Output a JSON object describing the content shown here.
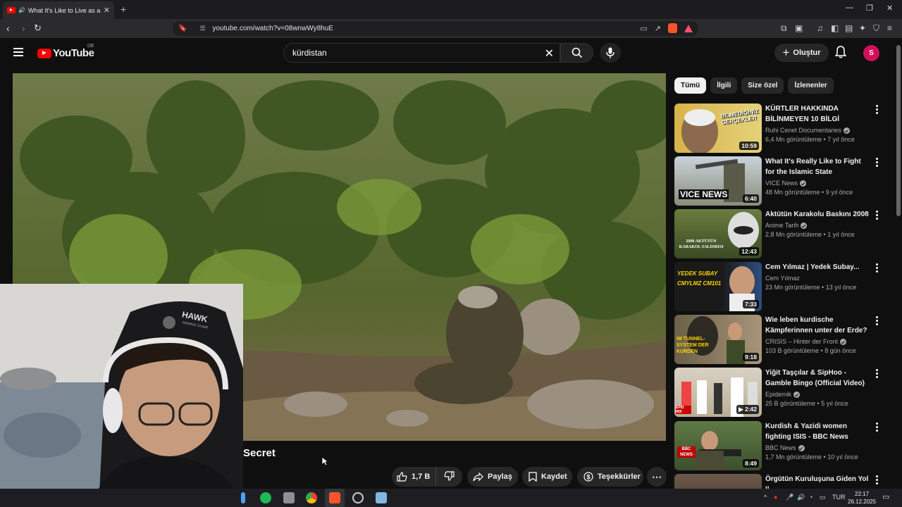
{
  "browser": {
    "tab_title": "What It's Like to Live as a PKK",
    "url": "youtube.com/watch?v=08wnwWy8huE"
  },
  "youtube": {
    "logo_text": "YouTube",
    "region": "DE",
    "search_value": "kürdistan",
    "create_label": "Oluştur",
    "avatar_letter": "S"
  },
  "video": {
    "title_visible": "Secret",
    "actions": {
      "likes": "1,7 B",
      "share": "Paylaş",
      "save": "Kaydet",
      "thanks": "Teşekkürler"
    }
  },
  "chips": [
    "Tümü",
    "İlgili",
    "Size özel",
    "İzlenenler"
  ],
  "recommendations": [
    {
      "title": "KÜRTLER HAKKINDA BİLİNMEYEN 10 BİLGİ",
      "channel": "Ruhi Cenet Documentaries",
      "meta": "6,4 Mn görüntüleme • 7 yıl önce",
      "duration": "10:59",
      "thumb_text": "BİLMEDİĞİNİZ GERÇEKLER"
    },
    {
      "title": "What It's Really Like to Fight for the Islamic State",
      "channel": "VICE News",
      "meta": "48 Mn görüntüleme • 9 yıl önce",
      "duration": "6:40",
      "thumb_text": "VICE NEWS"
    },
    {
      "title": "Aktütün Karakolu Baskını 2008",
      "channel": "Anime Tarih",
      "meta": "2,8 Mn görüntüleme • 1 yıl önce",
      "duration": "12:43",
      "thumb_text": "2008 AKTÜTÜN KARAKOL SALDIRISI"
    },
    {
      "title": "Cem Yılmaz | Yedek Subay...",
      "channel": "Cem Yılmaz",
      "meta": "23 Mn görüntüleme • 13 yıl önce",
      "duration": "7:33",
      "thumb_text": "YEDEK SUBAY CMYLMZ CM101"
    },
    {
      "title": "Wie leben kurdische Kämpferinnen unter der Erde?",
      "channel": "CRISIS – Hinter der Front",
      "meta": "103 B görüntüleme • 8 gün önce",
      "duration": "9:18",
      "thumb_text": "IM TUNNEL-SYSTEM DER KURDEN"
    },
    {
      "title": "Yiğit Taşçılar & SipHoo - Gamble Bingo (Official Video)",
      "channel": "Epidemik",
      "meta": "25 B görüntüleme • 5 yıl önce",
      "duration": "2:42",
      "thumb_text": "EPID MIK"
    },
    {
      "title": "Kurdish & Yazidi women fighting ISIS - BBC News",
      "channel": "BBC News",
      "meta": "1,7 Mn görüntüleme • 10 yıl önce",
      "duration": "8:49",
      "thumb_text": "BBC NEWS"
    },
    {
      "title": "Örgütün Kuruluşuna Giden Yol ||",
      "channel": "",
      "meta": "",
      "duration": "",
      "thumb_text": ""
    }
  ],
  "webcam": {
    "chair_text": "HAWK",
    "chair_sub": "GAMING CHAIR"
  },
  "taskbar": {
    "lang": "TUR",
    "time": "22:17",
    "date": "26.12.2025"
  },
  "colors": {
    "youtube_red": "#ff0000",
    "avatar": "#d1105b",
    "background": "#0f0f0f"
  }
}
